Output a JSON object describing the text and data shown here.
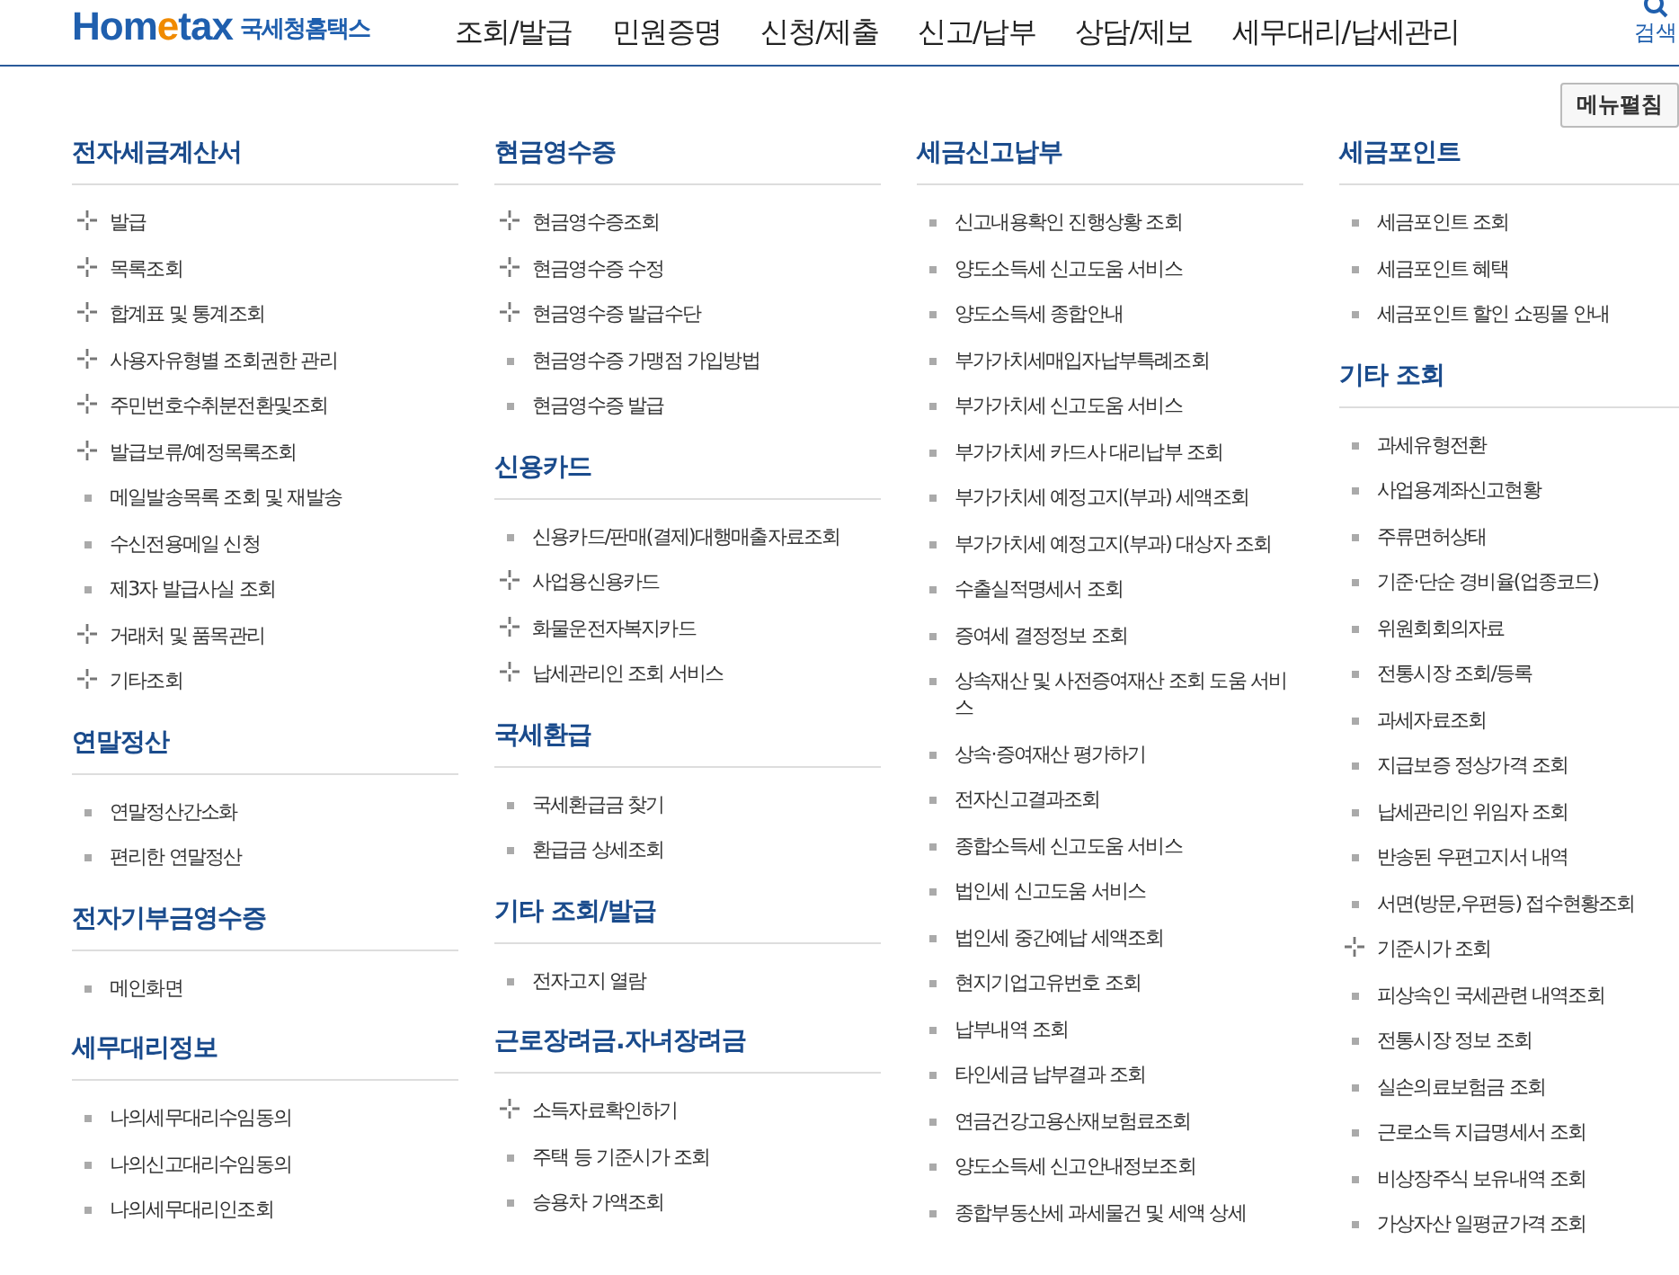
{
  "header": {
    "logo": {
      "brand": "Hom",
      "brand_accent": "e",
      "brand_end": "tax",
      "subtitle": "국세청홈택스"
    },
    "nav": [
      "조회/발급",
      "민원증명",
      "신청/제출",
      "신고/납부",
      "상담/제보",
      "세무대리/납세관리"
    ],
    "search_label": "검색"
  },
  "expand_button": "메뉴펼침",
  "columns": [
    [
      {
        "title": "전자세금계산서",
        "items": [
          {
            "kind": "expand",
            "label": "발급"
          },
          {
            "kind": "expand",
            "label": "목록조회"
          },
          {
            "kind": "expand",
            "label": "합계표 및 통계조회"
          },
          {
            "kind": "expand",
            "label": "사용자유형별 조회권한 관리"
          },
          {
            "kind": "expand",
            "label": "주민번호수취분전환및조회"
          },
          {
            "kind": "expand",
            "label": "발급보류/예정목록조회"
          },
          {
            "kind": "link",
            "label": "메일발송목록 조회 및 재발송"
          },
          {
            "kind": "link",
            "label": "수신전용메일 신청"
          },
          {
            "kind": "link",
            "label": "제3자 발급사실 조회"
          },
          {
            "kind": "expand",
            "label": "거래처 및 품목관리"
          },
          {
            "kind": "expand",
            "label": "기타조회"
          }
        ]
      },
      {
        "title": "연말정산",
        "items": [
          {
            "kind": "link",
            "label": "연말정산간소화"
          },
          {
            "kind": "link",
            "label": "편리한 연말정산"
          }
        ]
      },
      {
        "title": "전자기부금영수증",
        "items": [
          {
            "kind": "link",
            "label": "메인화면"
          }
        ]
      },
      {
        "title": "세무대리정보",
        "items": [
          {
            "kind": "link",
            "label": "나의세무대리수임동의"
          },
          {
            "kind": "link",
            "label": "나의신고대리수임동의"
          },
          {
            "kind": "link",
            "label": "나의세무대리인조회"
          }
        ]
      }
    ],
    [
      {
        "title": "현금영수증",
        "items": [
          {
            "kind": "expand",
            "label": "현금영수증조회"
          },
          {
            "kind": "expand",
            "label": "현금영수증 수정"
          },
          {
            "kind": "expand",
            "label": "현금영수증 발급수단"
          },
          {
            "kind": "link",
            "label": "현금영수증 가맹점 가입방법"
          },
          {
            "kind": "link",
            "label": "현금영수증 발급"
          }
        ]
      },
      {
        "title": "신용카드",
        "items": [
          {
            "kind": "link",
            "label": "신용카드/판매(결제)대행매출자료조회"
          },
          {
            "kind": "expand",
            "label": "사업용신용카드"
          },
          {
            "kind": "expand",
            "label": "화물운전자복지카드"
          },
          {
            "kind": "expand",
            "label": "납세관리인 조회 서비스"
          }
        ]
      },
      {
        "title": "국세환급",
        "items": [
          {
            "kind": "link",
            "label": "국세환급금 찾기"
          },
          {
            "kind": "link",
            "label": "환급금 상세조회"
          }
        ]
      },
      {
        "title": "기타 조회/발급",
        "items": [
          {
            "kind": "link",
            "label": "전자고지 열람"
          }
        ]
      },
      {
        "title": "근로장려금.자녀장려금",
        "items": [
          {
            "kind": "expand",
            "label": "소득자료확인하기"
          },
          {
            "kind": "link",
            "label": "주택 등 기준시가 조회"
          },
          {
            "kind": "link",
            "label": "승용차 가액조회"
          }
        ]
      }
    ],
    [
      {
        "title": "세금신고납부",
        "items": [
          {
            "kind": "link",
            "label": "신고내용확인 진행상황 조회"
          },
          {
            "kind": "link",
            "label": "양도소득세 신고도움 서비스"
          },
          {
            "kind": "link",
            "label": "양도소득세 종합안내"
          },
          {
            "kind": "link",
            "label": "부가가치세매입자납부특례조회"
          },
          {
            "kind": "link",
            "label": "부가가치세 신고도움 서비스"
          },
          {
            "kind": "link",
            "label": "부가가치세 카드사 대리납부 조회"
          },
          {
            "kind": "link",
            "label": "부가가치세 예정고지(부과) 세액조회"
          },
          {
            "kind": "link",
            "label": "부가가치세 예정고지(부과) 대상자 조회"
          },
          {
            "kind": "link",
            "label": "수출실적명세서 조회"
          },
          {
            "kind": "link",
            "label": "증여세 결정정보 조회"
          },
          {
            "kind": "link",
            "label": "상속재산 및 사전증여재산 조회 도움 서비스"
          },
          {
            "kind": "link",
            "label": "상속·증여재산 평가하기"
          },
          {
            "kind": "link",
            "label": "전자신고결과조회"
          },
          {
            "kind": "link",
            "label": "종합소득세 신고도움 서비스"
          },
          {
            "kind": "link",
            "label": "법인세 신고도움 서비스"
          },
          {
            "kind": "link",
            "label": "법인세 중간예납 세액조회"
          },
          {
            "kind": "link",
            "label": "현지기업고유번호 조회"
          },
          {
            "kind": "link",
            "label": "납부내역 조회"
          },
          {
            "kind": "link",
            "label": "타인세금 납부결과 조회"
          },
          {
            "kind": "link",
            "label": "연금건강고용산재보험료조회"
          },
          {
            "kind": "link",
            "label": "양도소득세 신고안내정보조회"
          },
          {
            "kind": "link",
            "label": "종합부동산세 과세물건 및 세액 상세"
          }
        ]
      }
    ],
    [
      {
        "title": "세금포인트",
        "items": [
          {
            "kind": "link",
            "label": "세금포인트 조회"
          },
          {
            "kind": "link",
            "label": "세금포인트 혜택"
          },
          {
            "kind": "link",
            "label": "세금포인트 할인 쇼핑몰 안내"
          }
        ]
      },
      {
        "title": "기타 조회",
        "items": [
          {
            "kind": "link",
            "label": "과세유형전환"
          },
          {
            "kind": "link",
            "label": "사업용계좌신고현황"
          },
          {
            "kind": "link",
            "label": "주류면허상태"
          },
          {
            "kind": "link",
            "label": "기준·단순 경비율(업종코드)"
          },
          {
            "kind": "link",
            "label": "위원회회의자료"
          },
          {
            "kind": "link",
            "label": "전통시장 조회/등록"
          },
          {
            "kind": "link",
            "label": "과세자료조회"
          },
          {
            "kind": "link",
            "label": "지급보증 정상가격 조회"
          },
          {
            "kind": "link",
            "label": "납세관리인 위임자 조회"
          },
          {
            "kind": "link",
            "label": "반송된 우편고지서 내역"
          },
          {
            "kind": "link",
            "label": "서면(방문,우편등) 접수현황조회"
          },
          {
            "kind": "expand",
            "label": "기준시가 조회"
          },
          {
            "kind": "link",
            "label": "피상속인 국세관련 내역조회"
          },
          {
            "kind": "link",
            "label": "전통시장 정보 조회"
          },
          {
            "kind": "link",
            "label": "실손의료보험금 조회"
          },
          {
            "kind": "link",
            "label": "근로소득 지급명세서 조회"
          },
          {
            "kind": "link",
            "label": "비상장주식 보유내역 조회"
          },
          {
            "kind": "link",
            "label": "가상자산 일평균가격 조회"
          }
        ]
      }
    ]
  ]
}
